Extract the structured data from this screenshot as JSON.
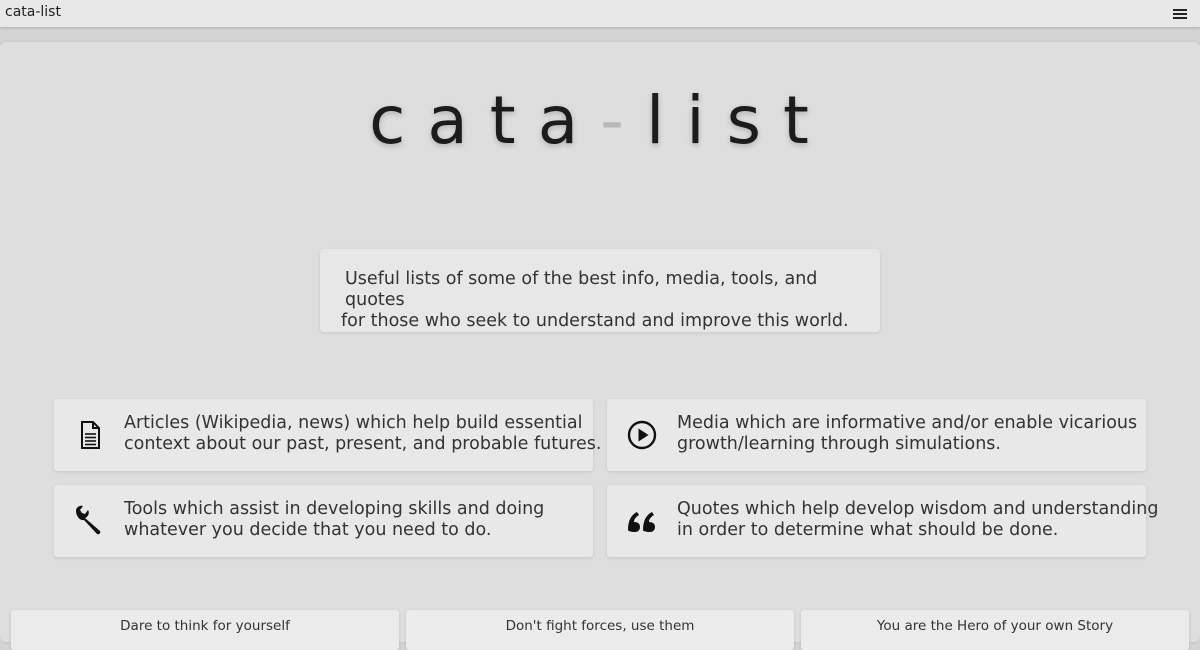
{
  "header": {
    "site_title": "cata-list",
    "menu_icon": "hamburger-menu-icon"
  },
  "hero": {
    "logo_left": "cata",
    "logo_dash": "-",
    "logo_right": "list"
  },
  "tagline": {
    "line1": "Useful lists of some of the best info, media, tools, and quotes",
    "line2": "for those who seek to understand and improve this world."
  },
  "categories": [
    {
      "icon": "document-icon",
      "line1": "Articles (Wikipedia, news) which help build essential",
      "line2": "context about our past, present, and probable futures."
    },
    {
      "icon": "play-circle-icon",
      "line1": "Media which are informative and/or enable vicarious",
      "line2": "growth/learning through simulations."
    },
    {
      "icon": "wrench-icon",
      "line1": "Tools which assist in developing skills and doing",
      "line2": "whatever you decide that you need to do."
    },
    {
      "icon": "quote-icon",
      "line1": "Quotes which help develop wisdom and understanding",
      "line2": "in order to determine what should be done."
    }
  ],
  "quotes": [
    "Dare to think for yourself",
    "Don't fight forces, use them",
    "You are the Hero of your own Story"
  ]
}
